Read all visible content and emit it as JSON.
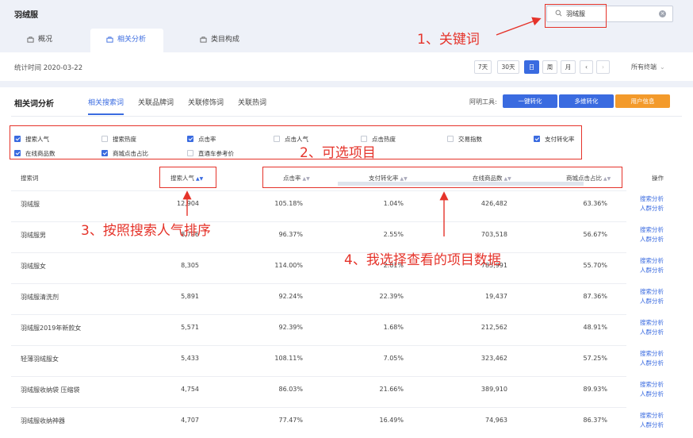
{
  "app": {
    "title": "羽绒服"
  },
  "search": {
    "value": "羽绒服"
  },
  "tabs": [
    {
      "label": "概况"
    },
    {
      "label": "相关分析"
    },
    {
      "label": "类目构成"
    }
  ],
  "datebar": {
    "date_text": "统计时间 2020-03-22",
    "ranges": [
      "7天",
      "30天",
      "日",
      "周",
      "月"
    ],
    "active_range": "日",
    "prev": "‹",
    "next": "›",
    "terminal": "所有终端"
  },
  "panel": {
    "title": "相关词分析",
    "subtabs": [
      "相关搜索词",
      "关联品牌词",
      "关联修饰词",
      "关联热词"
    ],
    "active_subtab": "相关搜索词",
    "tools_label": "阿明工具:",
    "tools": [
      "一键转化",
      "多维转化",
      "用户信息"
    ]
  },
  "options": [
    {
      "label": "搜索人气",
      "checked": true
    },
    {
      "label": "搜索热度",
      "checked": false
    },
    {
      "label": "点击率",
      "checked": true
    },
    {
      "label": "点击人气",
      "checked": false
    },
    {
      "label": "点击热度",
      "checked": false
    },
    {
      "label": "交易指数",
      "checked": false
    },
    {
      "label": "支付转化率",
      "checked": true
    },
    {
      "label": "在线商品数",
      "checked": true
    },
    {
      "label": "商城点击占比",
      "checked": true
    },
    {
      "label": "直通车参考价",
      "checked": false
    }
  ],
  "table": {
    "headers": [
      "搜索词",
      "搜索人气",
      "点击率",
      "支付转化率",
      "在线商品数",
      "商城点击占比",
      "操作"
    ],
    "actions": [
      "搜索分析",
      "人群分析"
    ],
    "rows": [
      [
        "羽绒服",
        "12,904",
        "105.18%",
        "1.04%",
        "426,482",
        "63.36%"
      ],
      [
        "羽绒服男",
        "8,796",
        "96.37%",
        "2.55%",
        "703,518",
        "56.67%"
      ],
      [
        "羽绒服女",
        "8,305",
        "114.00%",
        "2.01%",
        "785,991",
        "55.70%"
      ],
      [
        "羽绒服清洗剂",
        "5,891",
        "92.24%",
        "22.39%",
        "19,437",
        "87.36%"
      ],
      [
        "羽绒服2019年新款女",
        "5,571",
        "92.39%",
        "1.68%",
        "212,562",
        "48.91%"
      ],
      [
        "轻薄羽绒服女",
        "5,433",
        "108.11%",
        "7.05%",
        "323,462",
        "57.25%"
      ],
      [
        "羽绒服收纳袋 压缩袋",
        "4,754",
        "86.03%",
        "21.66%",
        "389,910",
        "89.93%"
      ],
      [
        "羽绒服收纳神器",
        "4,707",
        "77.47%",
        "16.49%",
        "74,963",
        "86.37%"
      ]
    ]
  },
  "annotations": {
    "a1": "1、关键词",
    "a2": "2、可选项目",
    "a3": "3、按照搜索人气排序",
    "a4": "4、我选择查看的项目数据"
  },
  "colors": {
    "accent": "#3a6be0",
    "annotation": "#e5332a",
    "orange": "#f39a2b"
  }
}
